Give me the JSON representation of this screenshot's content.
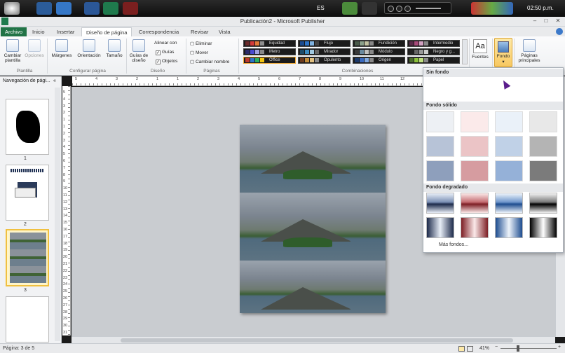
{
  "taskbar": {
    "language": "ES",
    "clock": "02:50 p.m."
  },
  "window": {
    "title": "Publicación2 - Microsoft Publisher",
    "minimize": "–",
    "maximize": "□",
    "close": "✕"
  },
  "tabs": [
    {
      "label": "Archivo"
    },
    {
      "label": "Inicio"
    },
    {
      "label": "Insertar"
    },
    {
      "label": "Diseño de página"
    },
    {
      "label": "Correspondencia"
    },
    {
      "label": "Revisar"
    },
    {
      "label": "Vista"
    }
  ],
  "ribbon": {
    "plantilla": {
      "cambiar": "Cambiar plantilla",
      "opciones": "Opciones",
      "label": "Plantilla"
    },
    "config": {
      "margenes": "Márgenes",
      "orientacion": "Orientación",
      "tamano": "Tamaño",
      "label": "Configurar página"
    },
    "diseno": {
      "guias": "Guías de diseño",
      "alinear": "Alinear con",
      "guias_chk": "Guías",
      "objetos_chk": "Objetos",
      "label": "Diseño"
    },
    "paginas": {
      "eliminar": "Eliminar",
      "mover": "Mover",
      "cambiar_nombre": "Cambiar nombre",
      "label": "Páginas"
    },
    "combinaciones": {
      "label": "Combinaciones",
      "schemes": [
        {
          "name": "Equidad"
        },
        {
          "name": "Flujo"
        },
        {
          "name": "Fundición"
        },
        {
          "name": "Intermedio"
        },
        {
          "name": "Metro"
        },
        {
          "name": "Mirador"
        },
        {
          "name": "Módulo"
        },
        {
          "name": "Negro y g..."
        },
        {
          "name": "Office"
        },
        {
          "name": "Opulento"
        },
        {
          "name": "Origen"
        },
        {
          "name": "Papel"
        }
      ]
    },
    "fuentes": "Fuentes",
    "fondo": "Fondo",
    "paginas_principales": "Páginas principales"
  },
  "nav": {
    "title": "Navegación de pági...",
    "pages": [
      "1",
      "2",
      "3"
    ]
  },
  "ruler": {
    "h": [
      "5",
      "4",
      "3",
      "2",
      "1",
      "1",
      "2",
      "3",
      "4",
      "5",
      "6",
      "7",
      "8",
      "9",
      "10",
      "11",
      "12"
    ],
    "v": [
      "5",
      "4",
      "3",
      "2",
      "1",
      "1",
      "2",
      "3",
      "4",
      "5",
      "6",
      "7",
      "8",
      "9",
      "10",
      "11",
      "12",
      "13",
      "14",
      "15",
      "16",
      "17",
      "18",
      "19",
      "20",
      "21",
      "22",
      "23",
      "24",
      "25",
      "26",
      "27",
      "28",
      "29",
      "30",
      "31"
    ]
  },
  "status": {
    "page": "Página: 3 de 5",
    "zoom": "41%"
  },
  "dropdown": {
    "sin_fondo": "Sin fondo",
    "fondo_solido": "Fondo sólido",
    "fondo_degradado": "Fondo degradado",
    "mas_fondos": "Más fondos...",
    "solid_colors": [
      "#edf0f4",
      "#fbeaea",
      "#eaf1f9",
      "#e8e8e8",
      "#b7c3d7",
      "#ebc4c6",
      "#c0d1e7",
      "#b4b4b4",
      "#8e9fbc",
      "#d69ca0",
      "#95b1d8",
      "#7b7b7b"
    ]
  }
}
